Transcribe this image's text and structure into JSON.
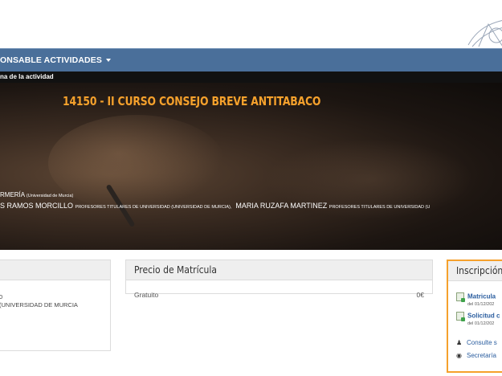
{
  "navbar": {
    "menu_label": "ONSABLE ACTIVIDADES"
  },
  "crumb": {
    "text": "na de la actividad"
  },
  "activity": {
    "title": "14150 - II CURSO CONSEJO BREVE ANTITABACO",
    "dept": "RMERÍA",
    "dept_org": "(Universidad de Murcia)",
    "prof1_name": "S RAMOS MORCILLO",
    "prof1_role": "PROFESORES TITULARES DE UNIVERSIDAD (UNIVERSIDAD DE MURCIA),",
    "prof2_name": "MARIA RUZAFA MARTINEZ",
    "prof2_role": "PROFESORES TITULARES DE UNIVERSIDAD (U"
  },
  "card_left": {
    "row1": "0",
    "row2": "(UNIVERSIDAD DE MURCIA"
  },
  "precio": {
    "title": "Precio de Matrícula",
    "name": "Gratuito",
    "value": "0€"
  },
  "inscripcion": {
    "title": "Inscripción A",
    "item1": "Matricula",
    "item1_sub": "del 01/12/202",
    "item2": "Solicitud c",
    "item2_sub": "del 01/12/202",
    "link1": "Consulte s",
    "link2": "Secretaría"
  }
}
